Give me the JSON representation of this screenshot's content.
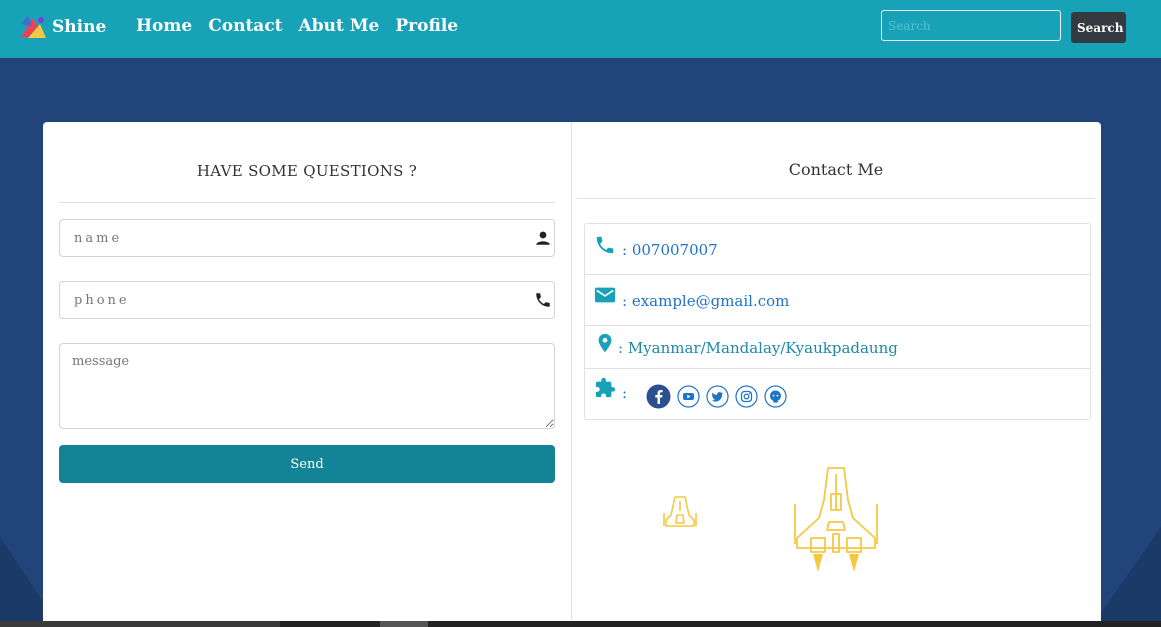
{
  "navbar": {
    "brand": "Shine",
    "links": [
      "Home",
      "Contact",
      "Abut Me",
      "Profile"
    ],
    "search_placeholder": "Search",
    "search_button": "Search"
  },
  "form": {
    "title": "HAVE SOME QUESTIONS ?",
    "name_placeholder": "name",
    "phone_placeholder": "phone",
    "message_placeholder": "message",
    "send_label": "Send"
  },
  "contact": {
    "title": "Contact Me",
    "phone": ": 007007007",
    "email": ": example@gmail.com",
    "address": ": Myanmar/Mandalay/Kyaukpadaung",
    "social_colon": ":",
    "social_icons": [
      "facebook-icon",
      "youtube-icon",
      "twitter-icon",
      "instagram-icon",
      "github-icon"
    ]
  },
  "colors": {
    "navbar": "#17a2b8",
    "background": "#21457a",
    "send_button": "#138496",
    "link": "#1f73c9",
    "icon_teal": "#17a2b8",
    "ship": "#f5c842"
  }
}
